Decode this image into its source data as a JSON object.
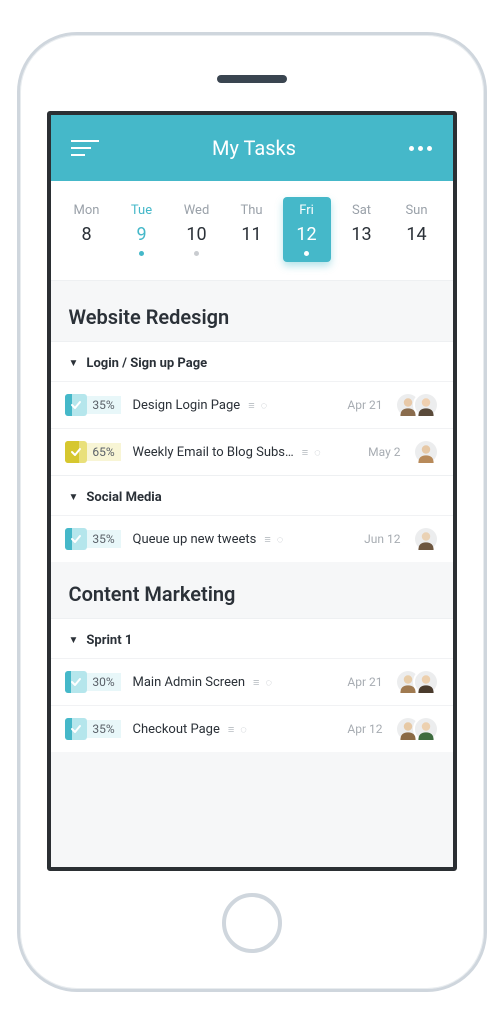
{
  "header": {
    "title": "My Tasks"
  },
  "colors": {
    "accent": "#45b8c9",
    "accent_light": "#b5e6ec",
    "yellow": "#d6c72f",
    "yellow_light": "#e9e07a"
  },
  "calendar": {
    "days": [
      {
        "label": "Mon",
        "num": "8",
        "state": ""
      },
      {
        "label": "Tue",
        "num": "9",
        "state": "today"
      },
      {
        "label": "Wed",
        "num": "10",
        "state": "muted"
      },
      {
        "label": "Thu",
        "num": "11",
        "state": ""
      },
      {
        "label": "Fri",
        "num": "12",
        "state": "selected"
      },
      {
        "label": "Sat",
        "num": "13",
        "state": ""
      },
      {
        "label": "Sun",
        "num": "14",
        "state": ""
      }
    ]
  },
  "projects": [
    {
      "name": "Website Redesign",
      "sections": [
        {
          "name": "Login / Sign up Page",
          "tasks": [
            {
              "pct": "35%",
              "pct_val": 35,
              "name": "Design Login Page",
              "date": "Apr 21",
              "color": "teal",
              "avatars": [
                "a",
                "b"
              ]
            },
            {
              "pct": "65%",
              "pct_val": 65,
              "name": "Weekly Email to Blog Subs…",
              "date": "May 2",
              "color": "yellow",
              "avatars": [
                "c"
              ]
            }
          ]
        },
        {
          "name": "Social Media",
          "tasks": [
            {
              "pct": "35%",
              "pct_val": 35,
              "name": "Queue up new tweets",
              "date": "Jun 12",
              "color": "teal",
              "avatars": [
                "d"
              ]
            }
          ]
        }
      ]
    },
    {
      "name": "Content Marketing",
      "sections": [
        {
          "name": "Sprint 1",
          "tasks": [
            {
              "pct": "30%",
              "pct_val": 30,
              "name": "Main Admin Screen",
              "date": "Apr 21",
              "color": "teal",
              "avatars": [
                "e",
                "f"
              ]
            },
            {
              "pct": "35%",
              "pct_val": 35,
              "name": "Checkout Page",
              "date": "Apr 12",
              "color": "teal",
              "avatars": [
                "g",
                "h"
              ]
            }
          ]
        }
      ]
    }
  ]
}
